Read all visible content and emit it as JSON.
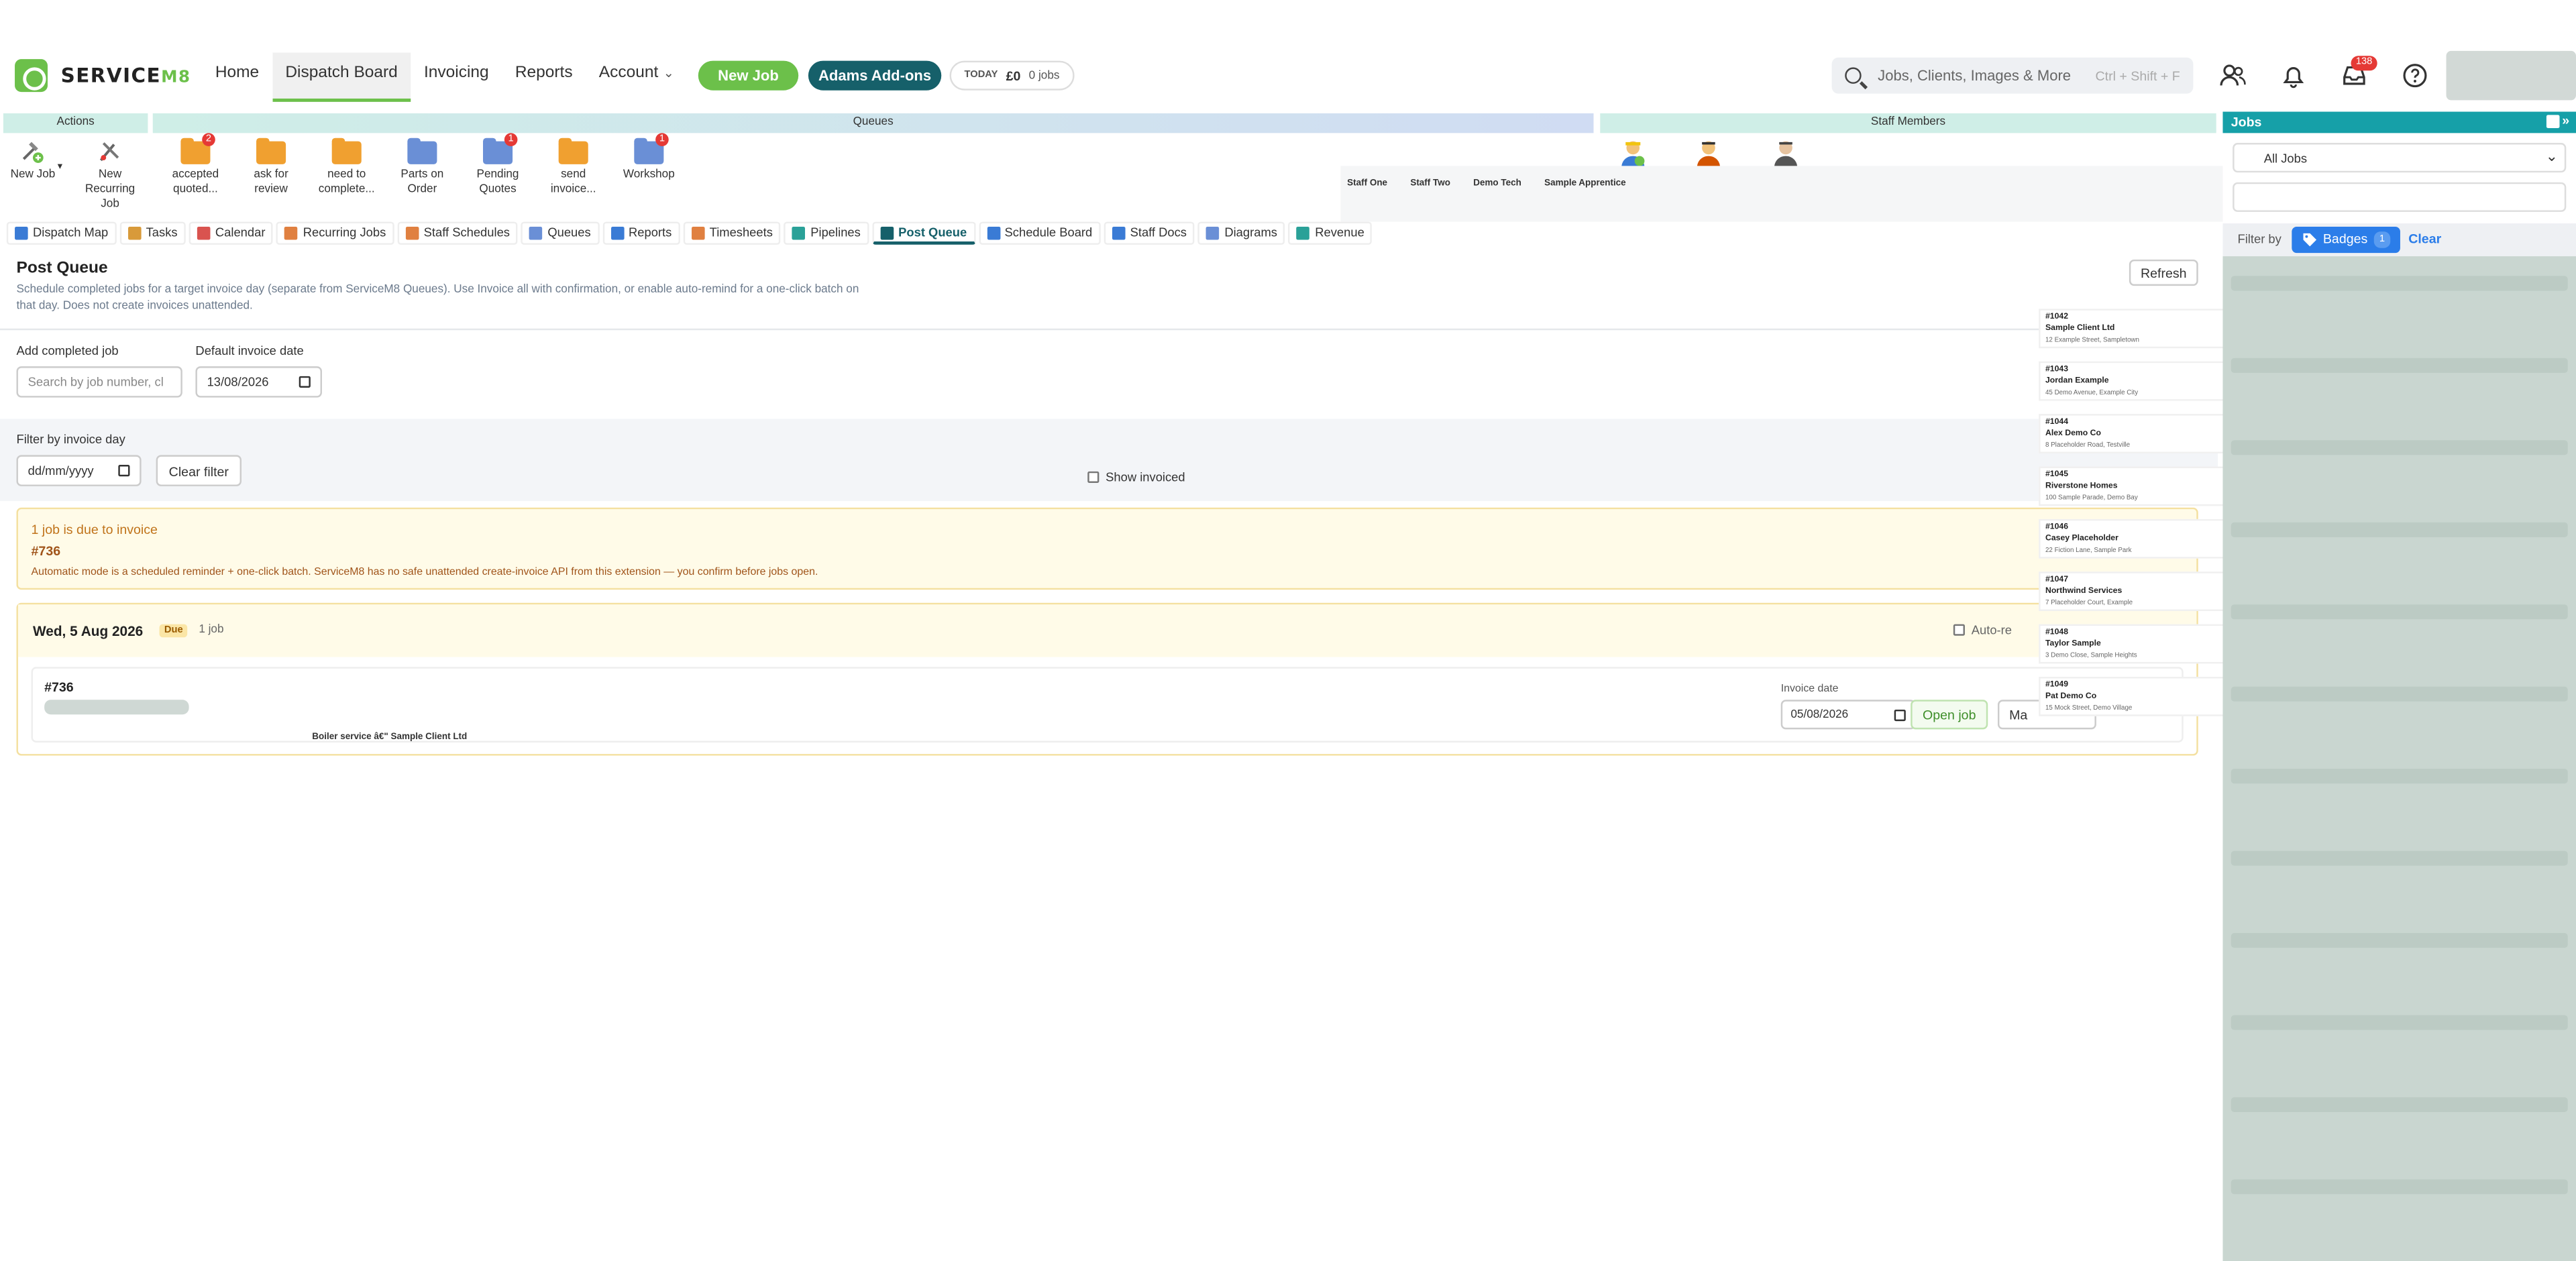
{
  "app": {
    "name": "SERVICE",
    "name_suffix": "M8"
  },
  "nav": {
    "items": [
      {
        "label": "Home"
      },
      {
        "label": "Dispatch Board"
      },
      {
        "label": "Invoicing"
      },
      {
        "label": "Reports"
      },
      {
        "label": "Account"
      }
    ],
    "new_job": "New Job",
    "addons": "Adams Add-ons",
    "today": {
      "label": "TODAY",
      "amount": "£0",
      "jobs": "0 jobs"
    }
  },
  "search": {
    "placeholder": "Jobs, Clients, Images & More",
    "shortcut": "Ctrl + Shift + F"
  },
  "inbox_count": "138",
  "panels": {
    "actions": "Actions",
    "queues": "Queues",
    "staff": "Staff Members"
  },
  "actions": [
    {
      "label": "New Job",
      "icon": "new-job-icon"
    },
    {
      "label": "New Recurring Job",
      "icon": "recurring-job-icon"
    }
  ],
  "queues": [
    {
      "label": "accepted quoted...",
      "badge": "2",
      "color": "#f0a030"
    },
    {
      "label": "ask for review",
      "badge": "",
      "color": "#f0a030"
    },
    {
      "label": "need to complete...",
      "badge": "",
      "color": "#f0a030"
    },
    {
      "label": "Parts on Order",
      "badge": "",
      "color": "#6a8fd6"
    },
    {
      "label": "Pending Quotes",
      "badge": "1",
      "color": "#6a8fd6"
    },
    {
      "label": "send invoice...",
      "badge": "",
      "color": "#f0a030"
    },
    {
      "label": "Workshop",
      "badge": "1",
      "color": "#6a8fd6"
    }
  ],
  "staff": [
    "Staff One",
    "Staff Two",
    "Demo Tech",
    "Sample Apprentice"
  ],
  "tabs": [
    {
      "label": "Dispatch Map",
      "color": "#3a7bd5"
    },
    {
      "label": "Tasks",
      "color": "#d89a3a"
    },
    {
      "label": "Calendar",
      "color": "#d9534f"
    },
    {
      "label": "Recurring Jobs",
      "color": "#e08040"
    },
    {
      "label": "Staff Schedules",
      "color": "#e08040"
    },
    {
      "label": "Queues",
      "color": "#6a8fd6"
    },
    {
      "label": "Reports",
      "color": "#3a7bd5"
    },
    {
      "label": "Timesheets",
      "color": "#e08040"
    },
    {
      "label": "Pipelines",
      "color": "#2aa198"
    },
    {
      "label": "Post Queue",
      "color": "#16606a"
    },
    {
      "label": "Schedule Board",
      "color": "#3a7bd5"
    },
    {
      "label": "Staff Docs",
      "color": "#3a7bd5"
    },
    {
      "label": "Diagrams",
      "color": "#6a8fd6"
    },
    {
      "label": "Revenue",
      "color": "#2aa198"
    }
  ],
  "post_queue": {
    "title": "Post Queue",
    "description": "Schedule completed jobs for a target invoice day (separate from ServiceM8 Queues). Use Invoice all with confirmation, or enable auto-remind for a one-click batch on that day. Does not create invoices unattended.",
    "refresh": "Refresh",
    "add_label": "Add completed job",
    "add_placeholder": "Search by job number, cl",
    "default_date_label": "Default invoice date",
    "default_date": "13/08/2026",
    "filter_label": "Filter by invoice day",
    "filter_date": "dd/mm/yyyy",
    "clear_filter": "Clear filter",
    "show_invoiced": "Show invoiced",
    "alert": {
      "title": "1 job is due to invoice",
      "job": "#736",
      "note": "Automatic mode is a scheduled reminder + one-click batch. ServiceM8 has no safe unattended create-invoice API from this extension — you confirm before jobs open."
    },
    "day": {
      "title": "Wed, 5 Aug 2026",
      "status": "Due",
      "count": "1 job",
      "auto_remind": "Auto-re"
    },
    "job": {
      "number": "#736",
      "description": "Boiler service â€\" Sample Client Ltd",
      "invoice_date_label": "Invoice date",
      "invoice_date": "05/08/2026",
      "open": "Open job",
      "mark": "Ma"
    }
  },
  "dropdown": [
    {
      "number": "#1042",
      "client": "Sample Client Ltd",
      "address": "12 Example Street, Sampletown"
    },
    {
      "number": "#1043",
      "client": "Jordan Example",
      "address": "45 Demo Avenue, Example City"
    },
    {
      "number": "#1044",
      "client": "Alex Demo Co",
      "address": "8 Placeholder Road, Testville"
    },
    {
      "number": "#1045",
      "client": "Riverstone Homes",
      "address": "100 Sample Parade, Demo Bay"
    },
    {
      "number": "#1046",
      "client": "Casey Placeholder",
      "address": "22 Fiction Lane, Sample Park"
    },
    {
      "number": "#1047",
      "client": "Northwind Services",
      "address": "7 Placeholder Court, Example"
    },
    {
      "number": "#1048",
      "client": "Taylor Sample",
      "address": "3 Demo Close, Sample Heights"
    },
    {
      "number": "#1049",
      "client": "Pat Demo Co",
      "address": "15 Mock Street, Demo Village"
    }
  ],
  "jobs_panel": {
    "title": "Jobs",
    "select": "All Jobs",
    "filter_label": "Filter by",
    "badges": "Badges",
    "badges_count": "1",
    "clear": "Clear"
  }
}
